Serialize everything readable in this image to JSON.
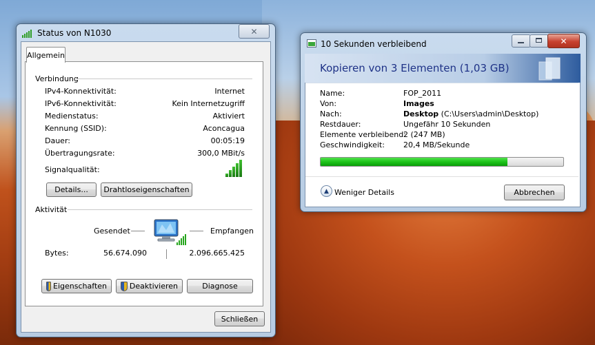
{
  "status_window": {
    "title": "Status von N1030",
    "close_label": "✕",
    "tab_label": "Allgemein",
    "connection": {
      "heading": "Verbindung",
      "rows": [
        {
          "label": "IPv4-Konnektivität:",
          "value": "Internet"
        },
        {
          "label": "IPv6-Konnektivität:",
          "value": "Kein Internetzugriff"
        },
        {
          "label": "Medienstatus:",
          "value": "Aktiviert"
        },
        {
          "label": "Kennung (SSID):",
          "value": "Aconcagua"
        },
        {
          "label": "Dauer:",
          "value": "00:05:19"
        },
        {
          "label": "Übertragungsrate:",
          "value": "300,0 MBit/s"
        }
      ],
      "signal_label": "Signalqualität:",
      "signal_bars": 5,
      "details_button": "Details...",
      "wireless_props_button": "Drahtloseigenschaften"
    },
    "activity": {
      "heading": "Aktivität",
      "sent_label": "Gesendet",
      "received_label": "Empfangen",
      "bytes_label": "Bytes:",
      "bytes_sent": "56.674.090",
      "bytes_received": "2.096.665.425"
    },
    "buttons": {
      "properties": "Eigenschaften",
      "deactivate": "Deaktivieren",
      "diagnose": "Diagnose",
      "close": "Schließen"
    }
  },
  "copy_window": {
    "title": "10 Sekunden verbleibend",
    "heading": "Kopieren von 3 Elementen (1,03 GB)",
    "details": {
      "name_label": "Name:",
      "name_value": "FOP_2011",
      "from_label": "Von:",
      "from_value": "Images",
      "to_label": "Nach:",
      "to_value_bold": "Desktop",
      "to_value_path": "(C:\\Users\\admin\\Desktop)",
      "remaining_label": "Restdauer:",
      "remaining_value": "Ungefähr 10 Sekunden",
      "items_label": "Elemente verbleibend:",
      "items_value": "2 (247 MB)",
      "speed_label": "Geschwindigkeit:",
      "speed_value": "20,4 MB/Sekunde"
    },
    "progress_fraction": 0.77,
    "fewer_details": "Weniger Details",
    "cancel_button": "Abbrechen",
    "close_label": "✕"
  },
  "colors": {
    "progress_green": "#1ec31a",
    "copy_heading": "#1e3287",
    "close_red": "#c7412f"
  }
}
